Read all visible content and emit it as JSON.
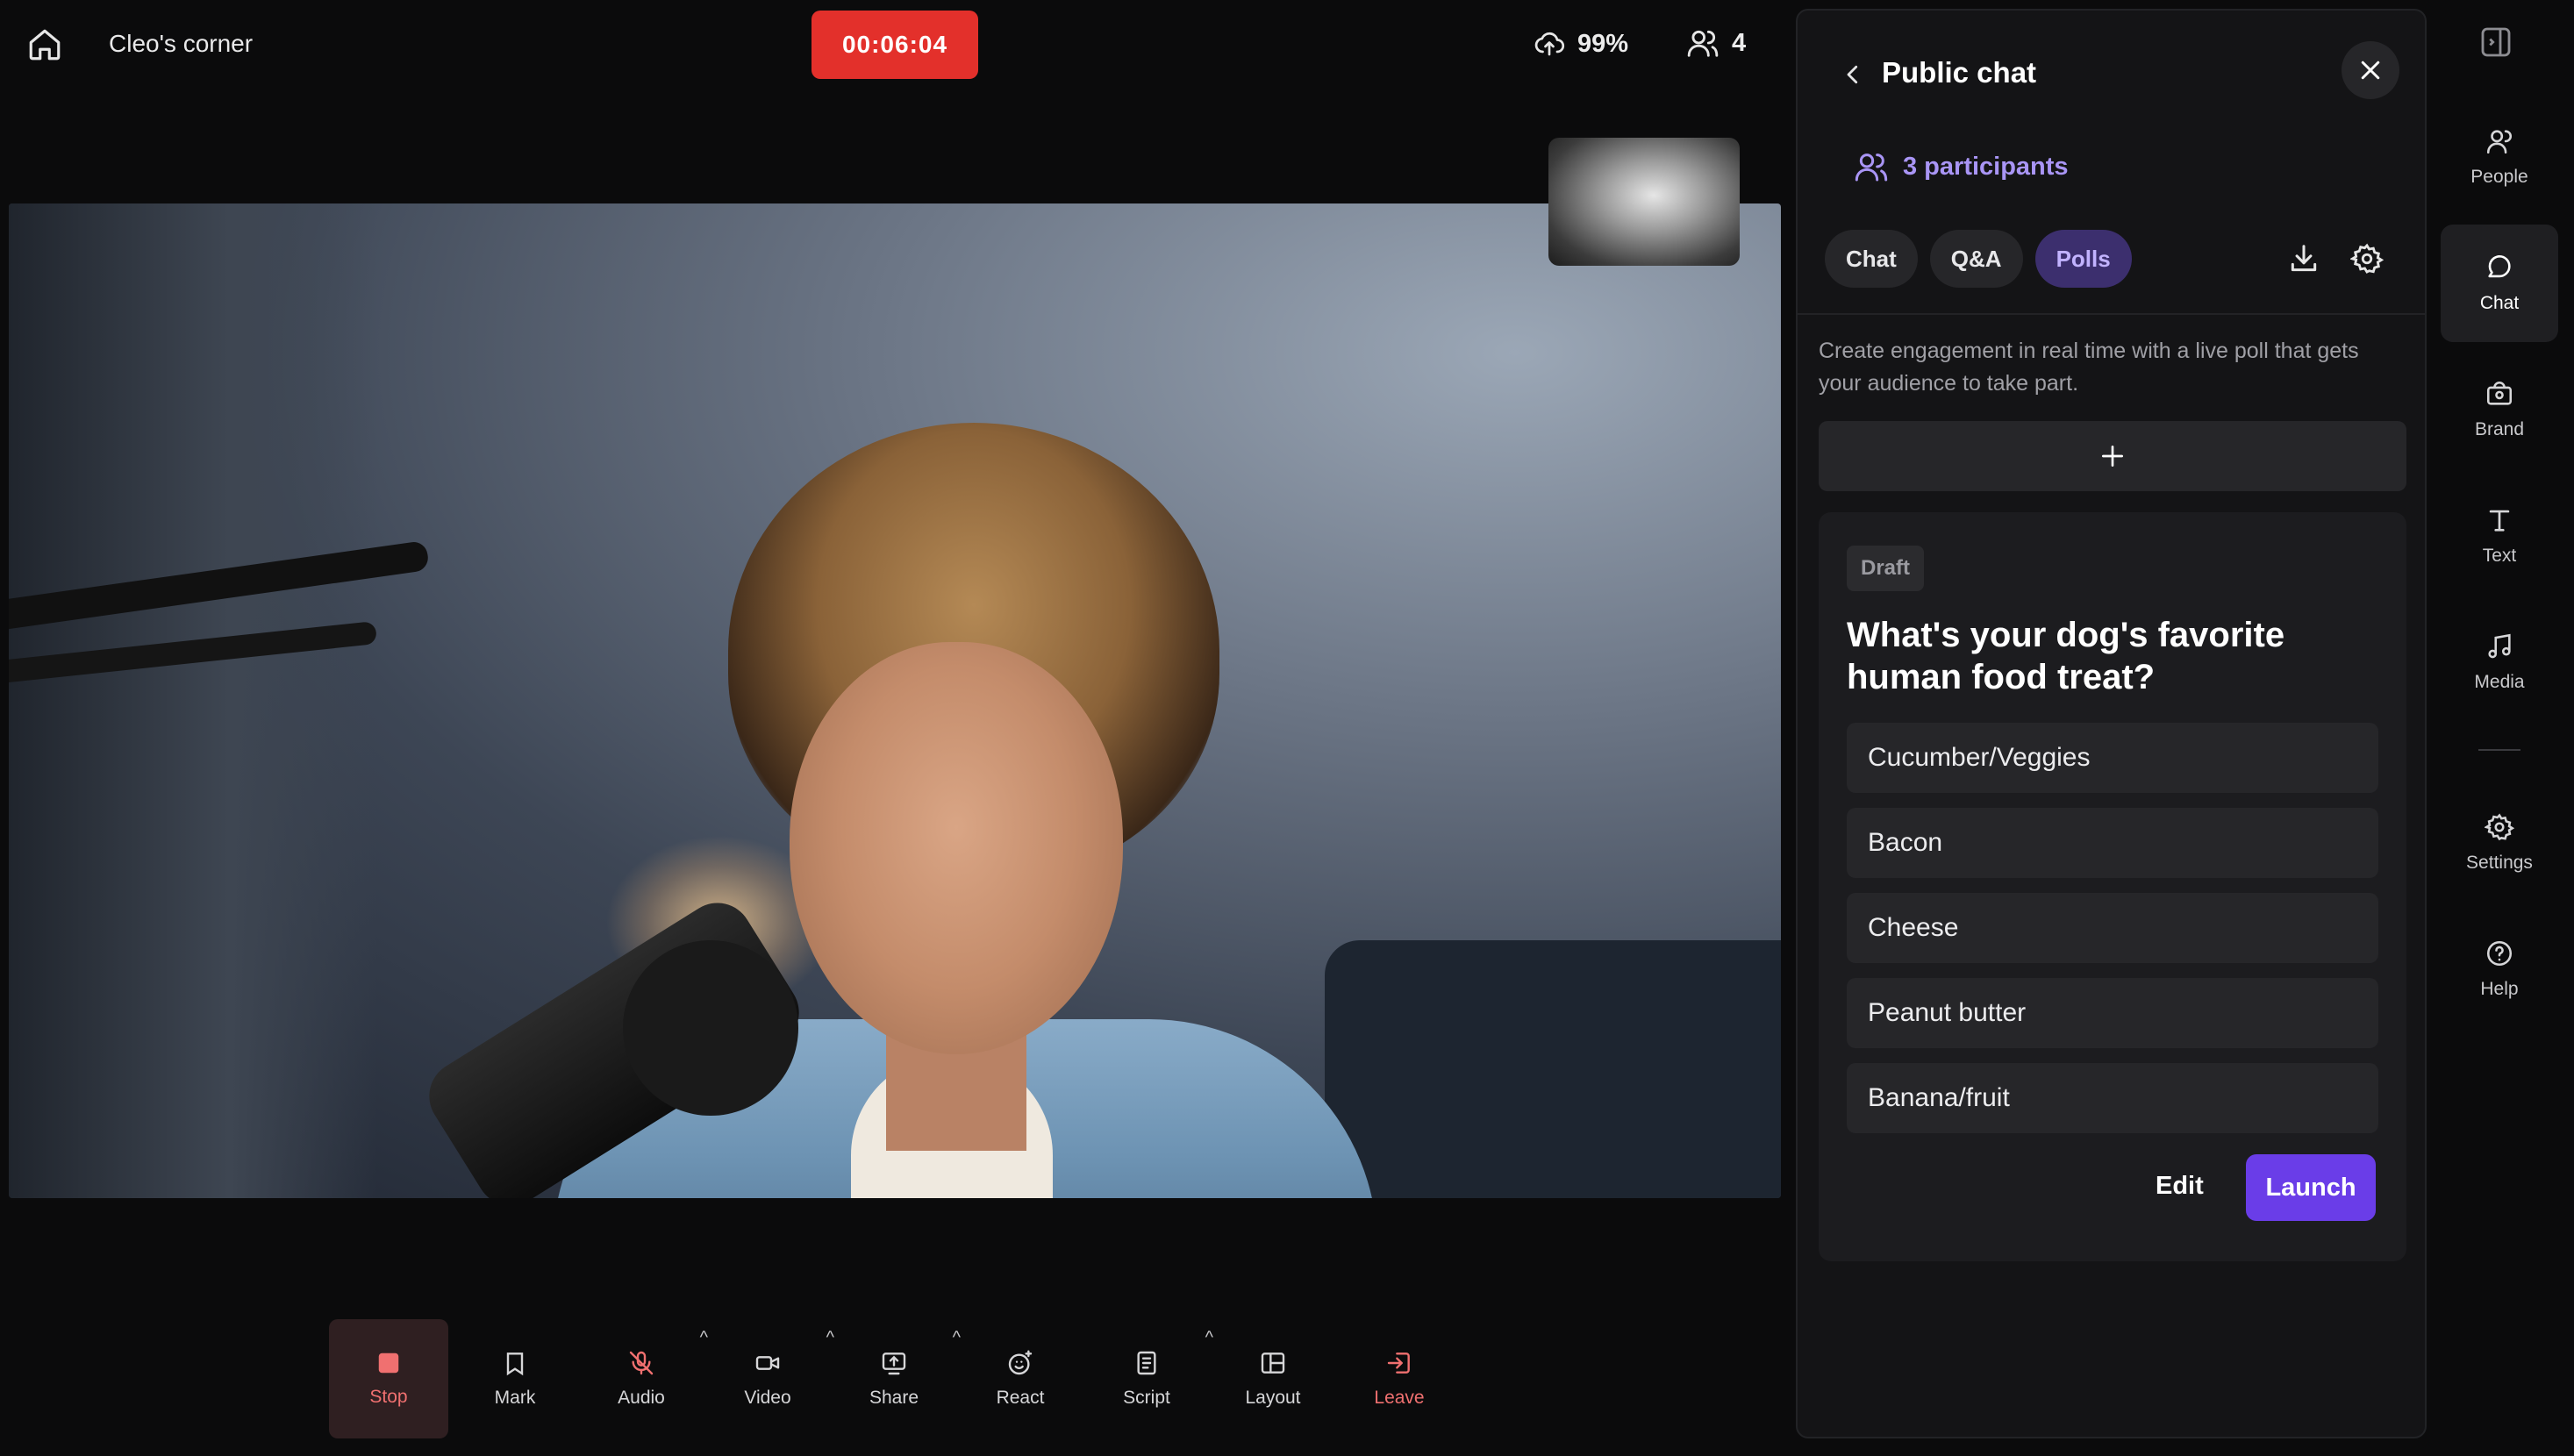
{
  "header": {
    "room_name": "Cleo's corner",
    "timer": "00:06:04",
    "upload_quality": "99%",
    "viewer_count": "4"
  },
  "toolbar": {
    "items": [
      {
        "label": "Stop",
        "icon": "stop-icon"
      },
      {
        "label": "Mark",
        "icon": "bookmark-icon"
      },
      {
        "label": "Audio",
        "icon": "mic-off-icon"
      },
      {
        "label": "Video",
        "icon": "camera-icon"
      },
      {
        "label": "Share",
        "icon": "screen-share-icon"
      },
      {
        "label": "React",
        "icon": "emoji-icon"
      },
      {
        "label": "Script",
        "icon": "document-icon"
      },
      {
        "label": "Layout",
        "icon": "layout-icon"
      },
      {
        "label": "Leave",
        "icon": "leave-icon"
      }
    ]
  },
  "panel": {
    "title": "Public chat",
    "participants": "3 participants",
    "tabs": [
      "Chat",
      "Q&A",
      "Polls"
    ],
    "active_tab": "Polls",
    "description": "Create engagement in real time with a live poll that gets your audience to take part.",
    "poll": {
      "status": "Draft",
      "question": "What's your dog's favorite human food treat?",
      "options": [
        "Cucumber/Veggies",
        "Bacon",
        "Cheese",
        "Peanut butter",
        "Banana/fruit"
      ],
      "edit_label": "Edit",
      "launch_label": "Launch"
    }
  },
  "sidenav": {
    "items": [
      {
        "label": "People",
        "icon": "people-icon"
      },
      {
        "label": "Chat",
        "icon": "chat-icon"
      },
      {
        "label": "Brand",
        "icon": "brand-icon"
      },
      {
        "label": "Text",
        "icon": "text-icon"
      },
      {
        "label": "Media",
        "icon": "music-note-icon"
      },
      {
        "label": "Settings",
        "icon": "gear-icon"
      },
      {
        "label": "Help",
        "icon": "help-icon"
      }
    ],
    "active": "Chat"
  },
  "colors": {
    "accent": "#6a3de8",
    "record_red": "#e3302b",
    "participants_purple": "#a995f5"
  }
}
